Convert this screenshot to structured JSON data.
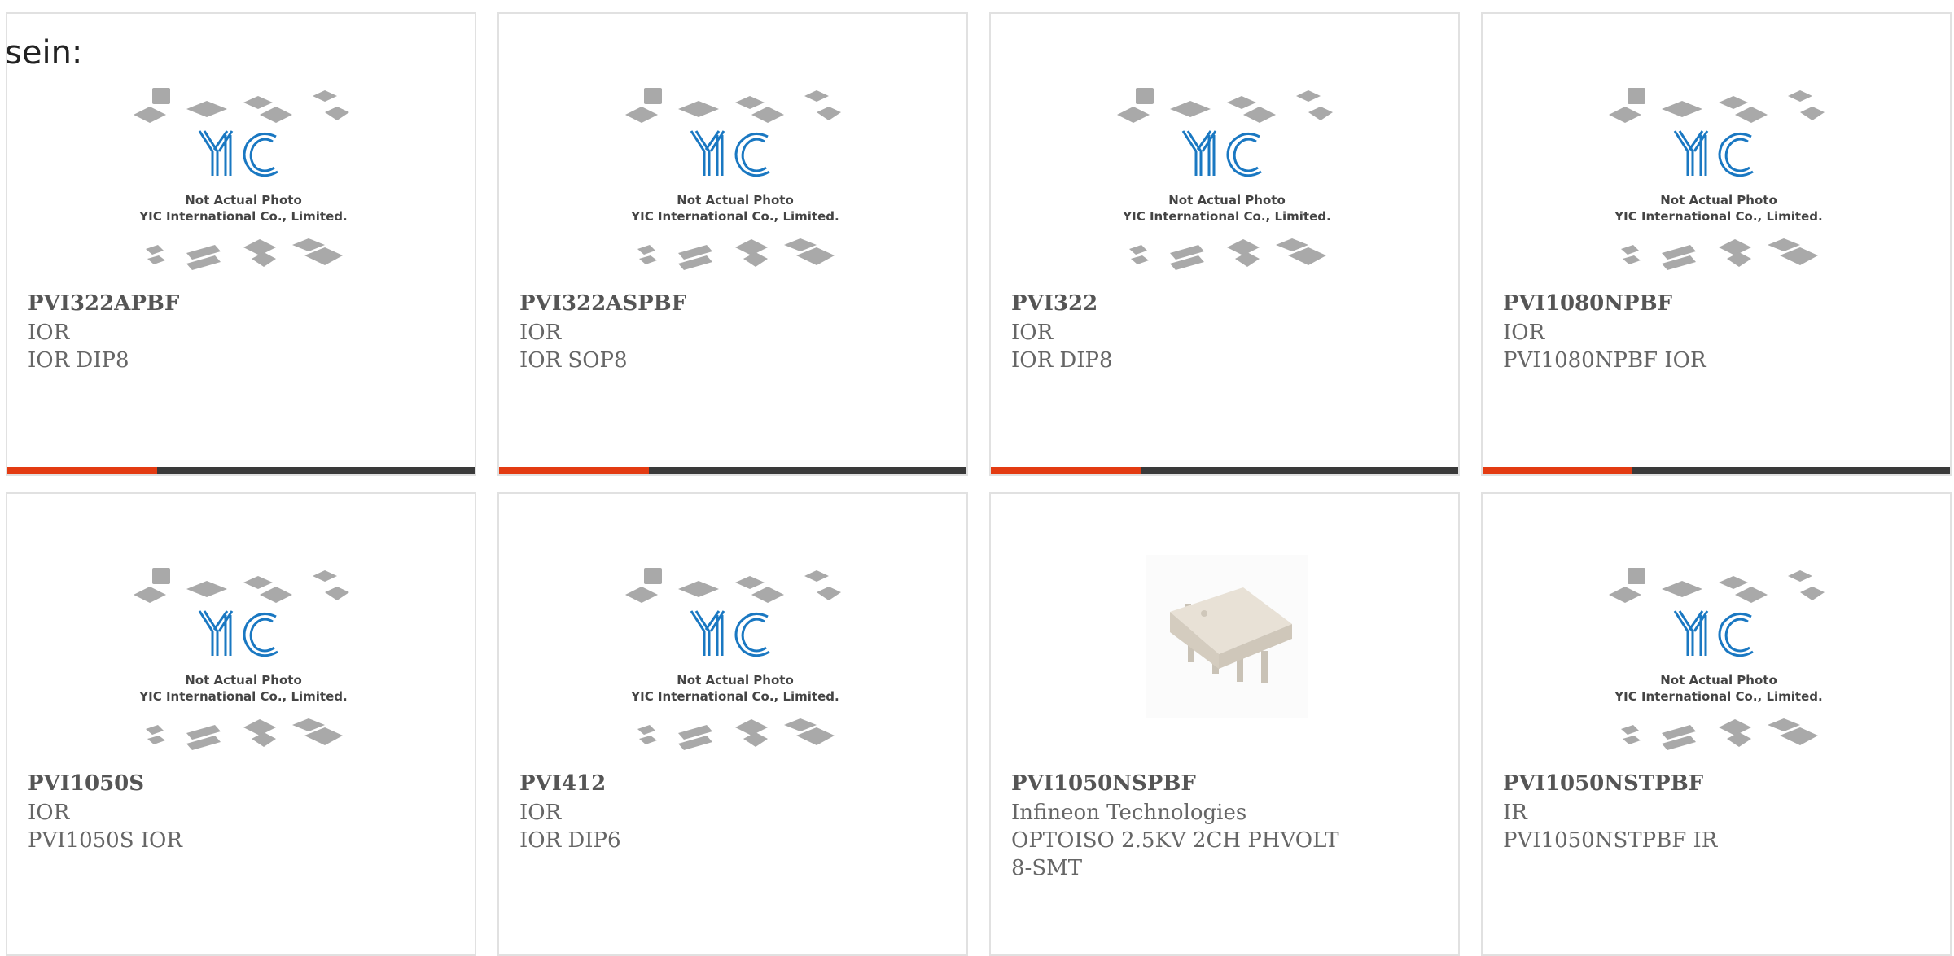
{
  "intro_text": "sein:",
  "placeholder": {
    "line1": "Not Actual Photo",
    "line2": "YIC International Co., Limited.",
    "logo": "YIC"
  },
  "colors": {
    "accent": "#e33b12",
    "bar_dark": "#3a3a3a",
    "card_border": "#e1e1e1",
    "logo_blue": "#1a78c2"
  },
  "bar_progress": 0.32,
  "products": [
    {
      "part": "PVI322APBF",
      "manufacturer": "IOR",
      "description": "IOR DIP8",
      "image": "placeholder"
    },
    {
      "part": "PVI322ASPBF",
      "manufacturer": "IOR",
      "description": "IOR SOP8",
      "image": "placeholder"
    },
    {
      "part": "PVI322",
      "manufacturer": "IOR",
      "description": "IOR DIP8",
      "image": "placeholder"
    },
    {
      "part": "PVI1080NPBF",
      "manufacturer": "IOR",
      "description": "PVI1080NPBF IOR",
      "image": "placeholder"
    },
    {
      "part": "PVI1050S",
      "manufacturer": "IOR",
      "description": "PVI1050S IOR",
      "image": "placeholder"
    },
    {
      "part": "PVI412",
      "manufacturer": "IOR",
      "description": "IOR DIP6",
      "image": "placeholder"
    },
    {
      "part": "PVI1050NSPBF",
      "manufacturer": "Infineon Technologies",
      "description": "OPTOISO 2.5KV 2CH PHVOLT 8-SMT",
      "image": "chip-photo"
    },
    {
      "part": "PVI1050NSTPBF",
      "manufacturer": "IR",
      "description": "PVI1050NSTPBF IR",
      "image": "placeholder"
    }
  ]
}
